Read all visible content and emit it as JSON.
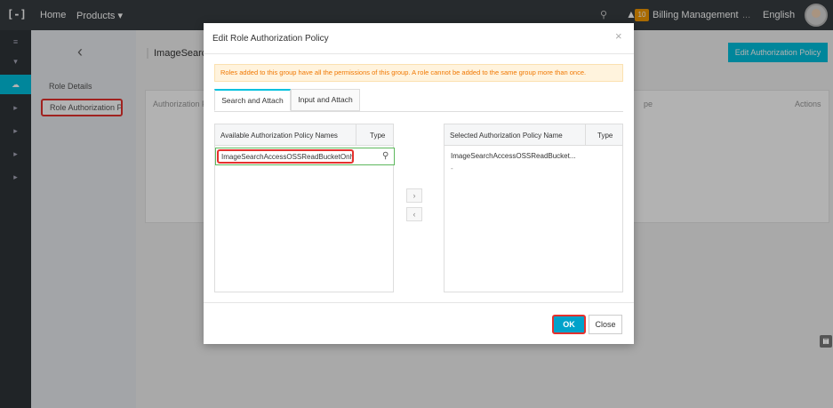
{
  "topbar": {
    "logo": "[-]",
    "home": "Home",
    "products": "Products ▾",
    "search_icon": "search-icon",
    "bell_icon": "bell-icon",
    "badge": "10",
    "billing": "Billing Management",
    "more": "...",
    "language": "English"
  },
  "sidebar": {
    "back": "‹",
    "role_details": "Role Details",
    "role_policy": "Role Authorization P..."
  },
  "main": {
    "title": "ImageSearchC",
    "edit_button": "Edit Authorization Policy",
    "table_headers": {
      "authorization": "Authorization Po",
      "type": "pe",
      "actions": "Actions"
    }
  },
  "dialog": {
    "title": "Edit Role Authorization Policy",
    "close": "×",
    "notice": "Roles added to this group have all the permissions of this group. A role cannot be added to the same group more than once.",
    "tabs": [
      "Search and Attach",
      "Input and Attach"
    ],
    "left_panel": {
      "header_name": "Available Authorization Policy Names",
      "header_type": "Type",
      "search_value": "ImageSearchAccessOSSReadBucketOnly"
    },
    "right_panel": {
      "header_name": "Selected Authorization Policy Name",
      "header_type": "Type",
      "selected_item": "ImageSearchAccessOSSReadBucket...",
      "selected_type": "-"
    },
    "transfer_right": "›",
    "transfer_left": "‹",
    "ok": "OK",
    "close_button": "Close"
  },
  "colors": {
    "accent": "#00c1de",
    "highlight": "#e5312d",
    "topbar": "#373d41"
  }
}
